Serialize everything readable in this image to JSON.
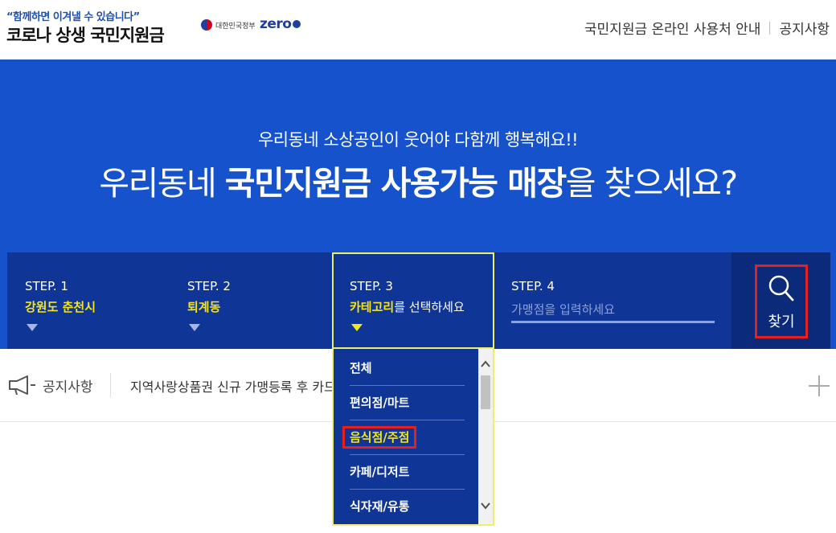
{
  "header": {
    "slogan": "“함께하면 이겨낼 수 있습니다”",
    "site_title": "코로나 상생 국민지원금",
    "gov_logo_text": "대한민국정부",
    "zero_logo_text": "zero",
    "nav": [
      "국민지원금 온라인 사용처 안내",
      "공지사항"
    ]
  },
  "banner": {
    "subtitle": "우리동네 소상공인이 웃어야 다함께 행복해요!!",
    "title_pre": "우리동네 ",
    "title_bold": "국민지원금 사용가능 매장",
    "title_post": "을 찾으세요?"
  },
  "steps": [
    {
      "title": "STEP. 1",
      "value": "강원도 춘천시"
    },
    {
      "title": "STEP. 2",
      "value": "퇴계동"
    },
    {
      "title": "STEP. 3",
      "value_highlight": "카테고리",
      "value_rest": "를 선택하세요"
    },
    {
      "title": "STEP. 4",
      "placeholder": "가맹점을 입력하세요"
    }
  ],
  "search": {
    "label": "찾기"
  },
  "notice": {
    "label": "공지사항",
    "text": "지역사랑상품권 신규 가맹등록 후 카드사 정보 반영까지"
  },
  "dropdown": {
    "items": [
      "전체",
      "편의점/마트",
      "음식점/주점",
      "카페/디저트",
      "식자재/유통"
    ],
    "selected": "음식점/주점"
  },
  "colors": {
    "banner_blue": "#1552cc",
    "steps_navy": "#0f3596",
    "highlight_yellow": "#f5e51b",
    "focus_red": "#e52020"
  }
}
